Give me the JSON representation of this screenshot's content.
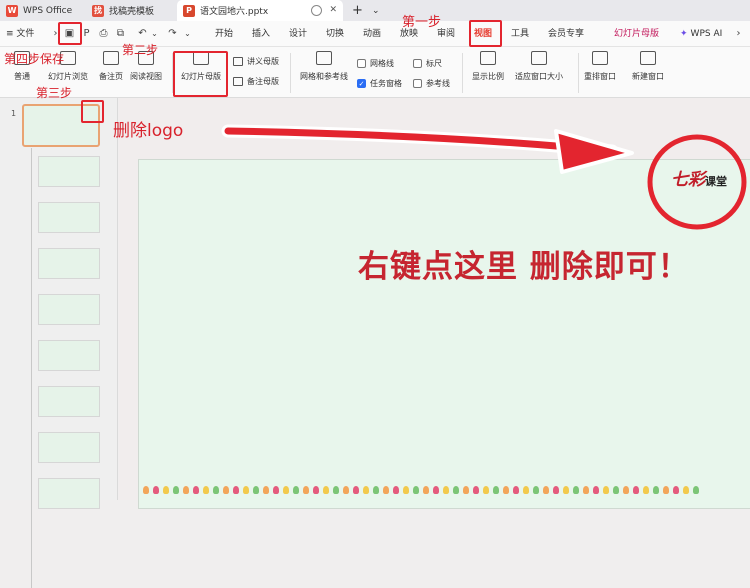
{
  "tabs": [
    {
      "label": "WPS Office",
      "icon": "wps-logo-icon"
    },
    {
      "label": "找稿壳模板",
      "icon": "template-icon"
    },
    {
      "label": "语文园地六.pptx",
      "icon": "ppt-file-icon",
      "active": true
    }
  ],
  "new_tab": "+",
  "tab_more": "⌄",
  "file_menu": "≡ 文件",
  "menu": [
    "开始",
    "插入",
    "设计",
    "切换",
    "动画",
    "放映",
    "审阅",
    "视图",
    "工具",
    "会员专享"
  ],
  "slide_master_tab": "幻灯片母版",
  "wps_ai": "WPS AI",
  "ribbon": {
    "normal": "普通",
    "sorter": "幻灯片浏览",
    "notes_page": "备注页",
    "reading": "阅读视图",
    "slide_master": "幻灯片母版",
    "handout_master": "讲义母版",
    "notes_master": "备注母版",
    "grid_guides": "网格和参考线",
    "gridlines": "网格线",
    "ruler": "标尺",
    "task_pane": "任务窗格",
    "guides": "参考线",
    "zoom": "显示比例",
    "fit_window": "适应窗口大小",
    "arrange": "重排窗口",
    "new_window": "新建窗口"
  },
  "slide_number": "1",
  "slide": {
    "logo_main": "七彩",
    "logo_sub": "课堂",
    "caption": "右键点这里 删除即可！"
  },
  "annotations": {
    "step1": "第一步",
    "step2": "第二步",
    "step3": "第三步",
    "step4": "第四步保存",
    "delete_logo": "删除logo"
  },
  "colors": {
    "annotation_red": "#d8222c",
    "active_view_tab": "#e63a2e",
    "slide_master_tab": "#c2185b",
    "slide_bg": "#e8f6ec"
  }
}
